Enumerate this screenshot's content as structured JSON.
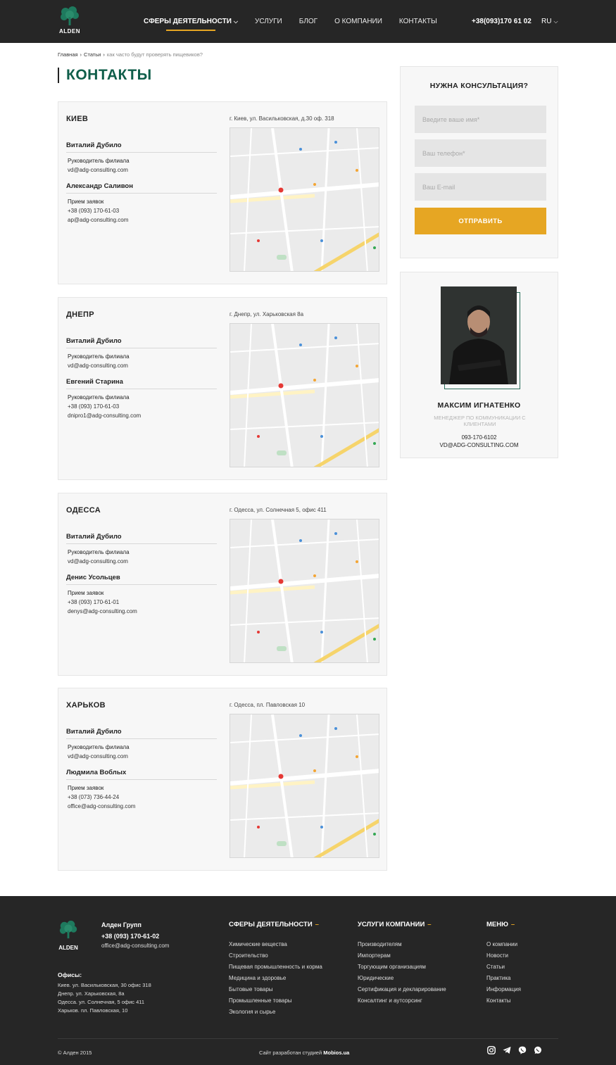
{
  "header": {
    "logo_text": "ALDEN",
    "nav": [
      {
        "label": "СФЕРЫ ДЕЯТЕЛЬНОСТИ",
        "active": true,
        "has_dropdown": true
      },
      {
        "label": "УСЛУГИ",
        "active": false
      },
      {
        "label": "БЛОГ",
        "active": false
      },
      {
        "label": "О КОМПАНИИ",
        "active": false
      },
      {
        "label": "КОНТАКТЫ",
        "active": false
      }
    ],
    "phone": "+38(093)170 61 02",
    "lang": "RU"
  },
  "breadcrumb": {
    "home": "Главная",
    "articles": "Статьи",
    "current": "как часто будут проверять пищевиков?"
  },
  "page_title": "КОНТАКТЫ",
  "offices": [
    {
      "city": "КИЕВ",
      "address": "г. Киев, ул. Васильковская, д.30 оф. 318",
      "people": [
        {
          "name": "Виталий Дубило",
          "role": "Руководитель филиала",
          "lines": [
            "vd@adg-consulting.com"
          ]
        },
        {
          "name": "Александр Саливон",
          "role": "Прием заявок",
          "lines": [
            "+38 (093) 170-61-03",
            "ap@adg-consulting.com"
          ]
        }
      ]
    },
    {
      "city": "ДНЕПР",
      "address": "г. Днепр, ул. Харьковская 8а",
      "people": [
        {
          "name": "Виталий Дубило",
          "role": "Руководитель филиала",
          "lines": [
            "vd@adg-consulting.com"
          ]
        },
        {
          "name": "Евгений Старина",
          "role": "Руководитель филиала",
          "lines": [
            "+38 (093) 170-61-03",
            "dnipro1@adg-consulting.com"
          ]
        }
      ]
    },
    {
      "city": "ОДЕССА",
      "address": "г. Одесса, ул. Солнечная 5, офис 411",
      "people": [
        {
          "name": "Виталий Дубило",
          "role": "Руководитель филиала",
          "lines": [
            "vd@adg-consulting.com"
          ]
        },
        {
          "name": "Денис Усольцев",
          "role": "Прием заявок",
          "lines": [
            "+38 (093) 170-61-01",
            "denys@adg-consulting.com"
          ]
        }
      ]
    },
    {
      "city": "ХАРЬКОВ",
      "address": "г. Одесса, пл. Павловская 10",
      "people": [
        {
          "name": "Виталий Дубило",
          "role": "Руководитель филиала",
          "lines": [
            "vd@adg-consulting.com"
          ]
        },
        {
          "name": "Людмила Воблых",
          "role": "Прием заявок",
          "lines": [
            "+38 (073) 736-44-24",
            "office@adg-consulting.com"
          ]
        }
      ]
    }
  ],
  "consultation": {
    "title": "НУЖНА КОНСУЛЬТАЦИЯ?",
    "name_placeholder": "Введите ваше имя*",
    "phone_placeholder": "Ваш телефон*",
    "email_placeholder": "Ваш E-mail",
    "submit": "ОТПРАВИТЬ",
    "submit_color": "#e6a623"
  },
  "manager": {
    "name": "МАКСИМ ИГНАТЕНКО",
    "role": "МЕНЕДЖЕР ПО КОММУНИКАЦИИ С КЛИЕНТАМИ",
    "phone": "093-170-6102",
    "email": "VD@ADG-CONSULTING.COM"
  },
  "footer": {
    "logo_text": "ALDEN",
    "company": "Алден Групп",
    "phone": "+38 (093) 170-61-02",
    "email": "office@adg-consulting.com",
    "offices_title": "Офисы:",
    "offices": [
      "Киев. ул. Васильковская, 30 офис 318",
      "Днепр. ул. Харьковская, 8а",
      "Одесса. ул. Солнечная, 5 офис 411",
      "Харьков. пл. Павловская, 10"
    ],
    "columns": [
      {
        "title": "СФЕРЫ ДЕЯТЕЛЬНОСТИ",
        "items": [
          "Химические вещества",
          "Строительство",
          "Пищевая промышленность и корма",
          "Медицина и здоровье",
          "Бытовые товары",
          "Промышленные товары",
          "Экология и сырье"
        ]
      },
      {
        "title": "УСЛУГИ КОМПАНИИ",
        "items": [
          "Производителям",
          "Импортерам",
          "Торгующим организациям",
          "Юридические",
          "Сертификация и декларирование",
          "Консалтинг и аутсорсинг"
        ]
      },
      {
        "title": "МЕНЮ",
        "items": [
          "О компании",
          "Новости",
          "Статьи",
          "Практика",
          "Информация",
          "Контакты"
        ]
      }
    ],
    "copyright": "© Алден 2015",
    "dev_prefix": "Сайт разработан студией",
    "dev_name": "Mobios.ua",
    "socials": [
      "instagram-icon",
      "telegram-icon",
      "viber-icon",
      "whatsapp-icon"
    ]
  },
  "colors": {
    "accent": "#e6a623",
    "brand_green": "#0f5e4a",
    "dark": "#262626"
  }
}
